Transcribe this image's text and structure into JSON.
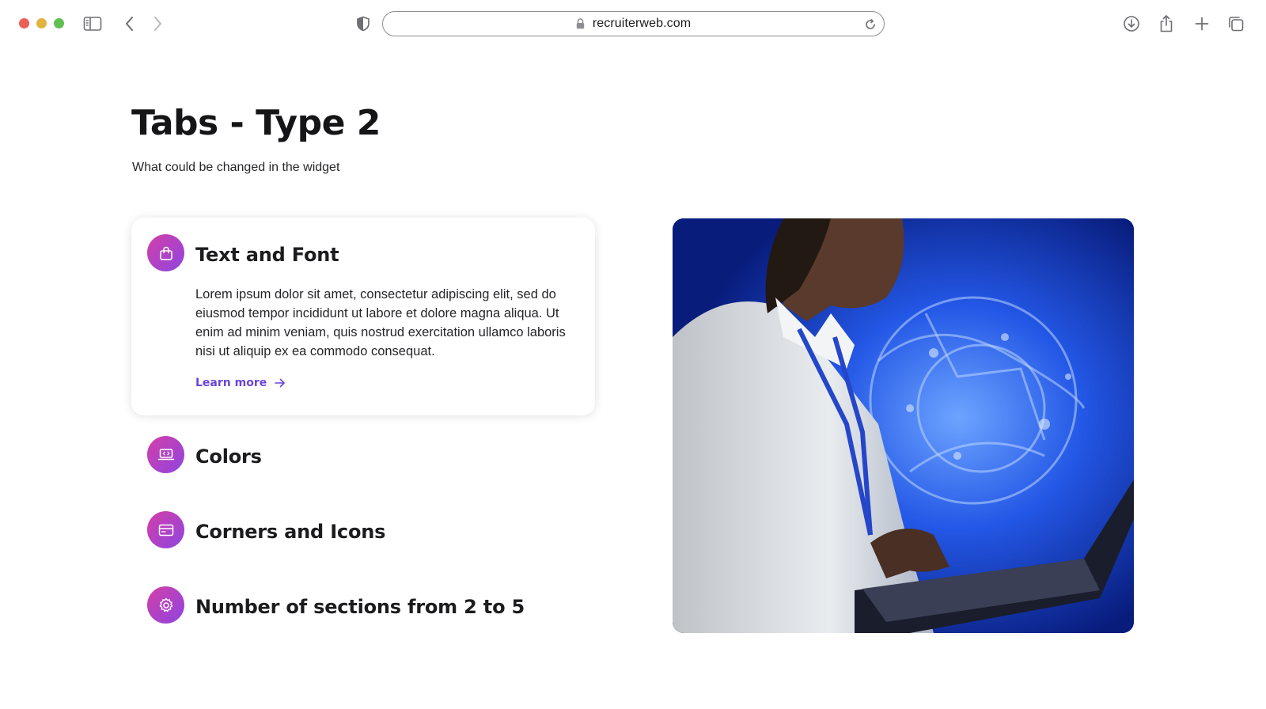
{
  "browser": {
    "url": "recruiterweb.com"
  },
  "page": {
    "title": "Tabs - Type 2",
    "subtitle": "What could be changed in the widget"
  },
  "tabs": [
    {
      "title": "Text and Font",
      "icon": "shopping-bag-icon",
      "expanded": true,
      "description": "Lorem ipsum dolor sit amet, consectetur adipiscing elit, sed do eiusmod tempor incididunt ut labore et dolore magna aliqua. Ut enim ad minim veniam, quis nostrud exercitation ullamco laboris nisi ut aliquip ex ea commodo consequat.",
      "link_label": "Learn more"
    },
    {
      "title": "Colors",
      "icon": "laptop-code-icon",
      "expanded": false
    },
    {
      "title": "Corners and Icons",
      "icon": "browser-window-icon",
      "expanded": false
    },
    {
      "title": "Number of sections from 2 to 5",
      "icon": "gear-icon",
      "expanded": false
    }
  ],
  "colors": {
    "icon_gradient_start": "#d43fa8",
    "icon_gradient_end": "#8e45e0",
    "link": "#6a45d8",
    "hero_background": "#0b2aa3"
  }
}
